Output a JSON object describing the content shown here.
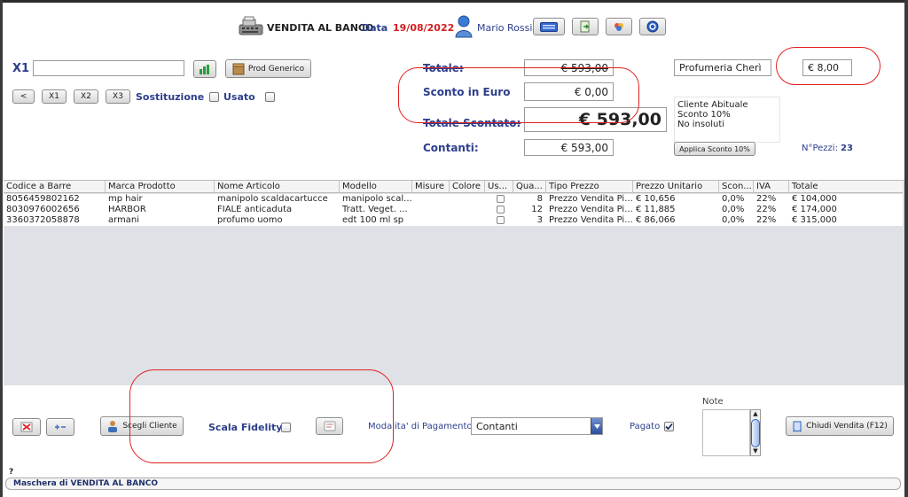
{
  "header": {
    "title": "VENDITA AL BANCO",
    "date_label": "Data",
    "date_value": "19/08/2022",
    "user_name": "Mario Rossi"
  },
  "toolbar_left": {
    "x1_label": "X1",
    "x1_value": "",
    "prod_generico": "Prod Generico",
    "btn_back": "<",
    "btn_x1": "X1",
    "btn_x2": "X2",
    "btn_x3": "X3",
    "sostituzione": "Sostituzione",
    "usato": "Usato"
  },
  "totals": {
    "totale_label": "Totale:",
    "totale_value": "€ 593,00",
    "sconto_label": "Sconto in Euro",
    "sconto_value": "€ 0,00",
    "scontato_label": "Totale Scontato:",
    "scontato_value": "€ 593,00",
    "contanti_label": "Contanti:",
    "contanti_value": "€ 593,00"
  },
  "customer": {
    "name": "Profumeria Cherì",
    "credit": "€ 8,00",
    "note_line1": "Cliente Abituale Sconto 10%",
    "note_line2": "No insoluti",
    "apply_discount": "Applica Sconto 10%",
    "pezzi_label": "N°Pezzi:",
    "pezzi_value": "23"
  },
  "table": {
    "headers": [
      "Codice a Barre",
      "Marca Prodotto",
      "Nome Articolo",
      "Modello",
      "Misure",
      "Colore",
      "Us...",
      "Qua...",
      "Tipo Prezzo",
      "Prezzo Unitario",
      "Scon...",
      "IVA",
      "Totale"
    ],
    "rows": [
      [
        "8056459802162",
        "mp hair",
        "manipolo scaldacartucce",
        "manipolo scal...",
        "",
        "",
        "",
        "8",
        "Prezzo Vendita Pi...",
        "€ 10,656",
        "0,0%",
        "22%",
        "€ 104,000"
      ],
      [
        "8030976002656",
        "HARBOR",
        "FIALE anticaduta",
        "Tratt. Veget. ...",
        "",
        "",
        "",
        "12",
        "Prezzo Vendita Pi...",
        "€ 11,885",
        "0,0%",
        "22%",
        "€ 174,000"
      ],
      [
        "3360372058878",
        "armani",
        "profumo uomo",
        "edt 100 ml sp",
        "",
        "",
        "",
        "3",
        "Prezzo Vendita Pi...",
        "€ 86,066",
        "0,0%",
        "22%",
        "€ 315,000"
      ]
    ]
  },
  "footer": {
    "scegli_cliente": "Scegli Cliente",
    "scala_fidelity": "Scala Fidelity",
    "modalita_label": "Modalita' di Pagamento",
    "modalita_value": "Contanti",
    "pagato_label": "Pagato",
    "note_label": "Note",
    "chiudi": "Chiudi Vendita (F12)",
    "question": "?",
    "status": "Maschera di VENDITA AL BANCO"
  },
  "colors": {
    "accent_blue": "#2d3e8c",
    "date_red": "#d21f1f",
    "annotation_red": "#e02020",
    "grid_bg": "#dfe1e6"
  }
}
